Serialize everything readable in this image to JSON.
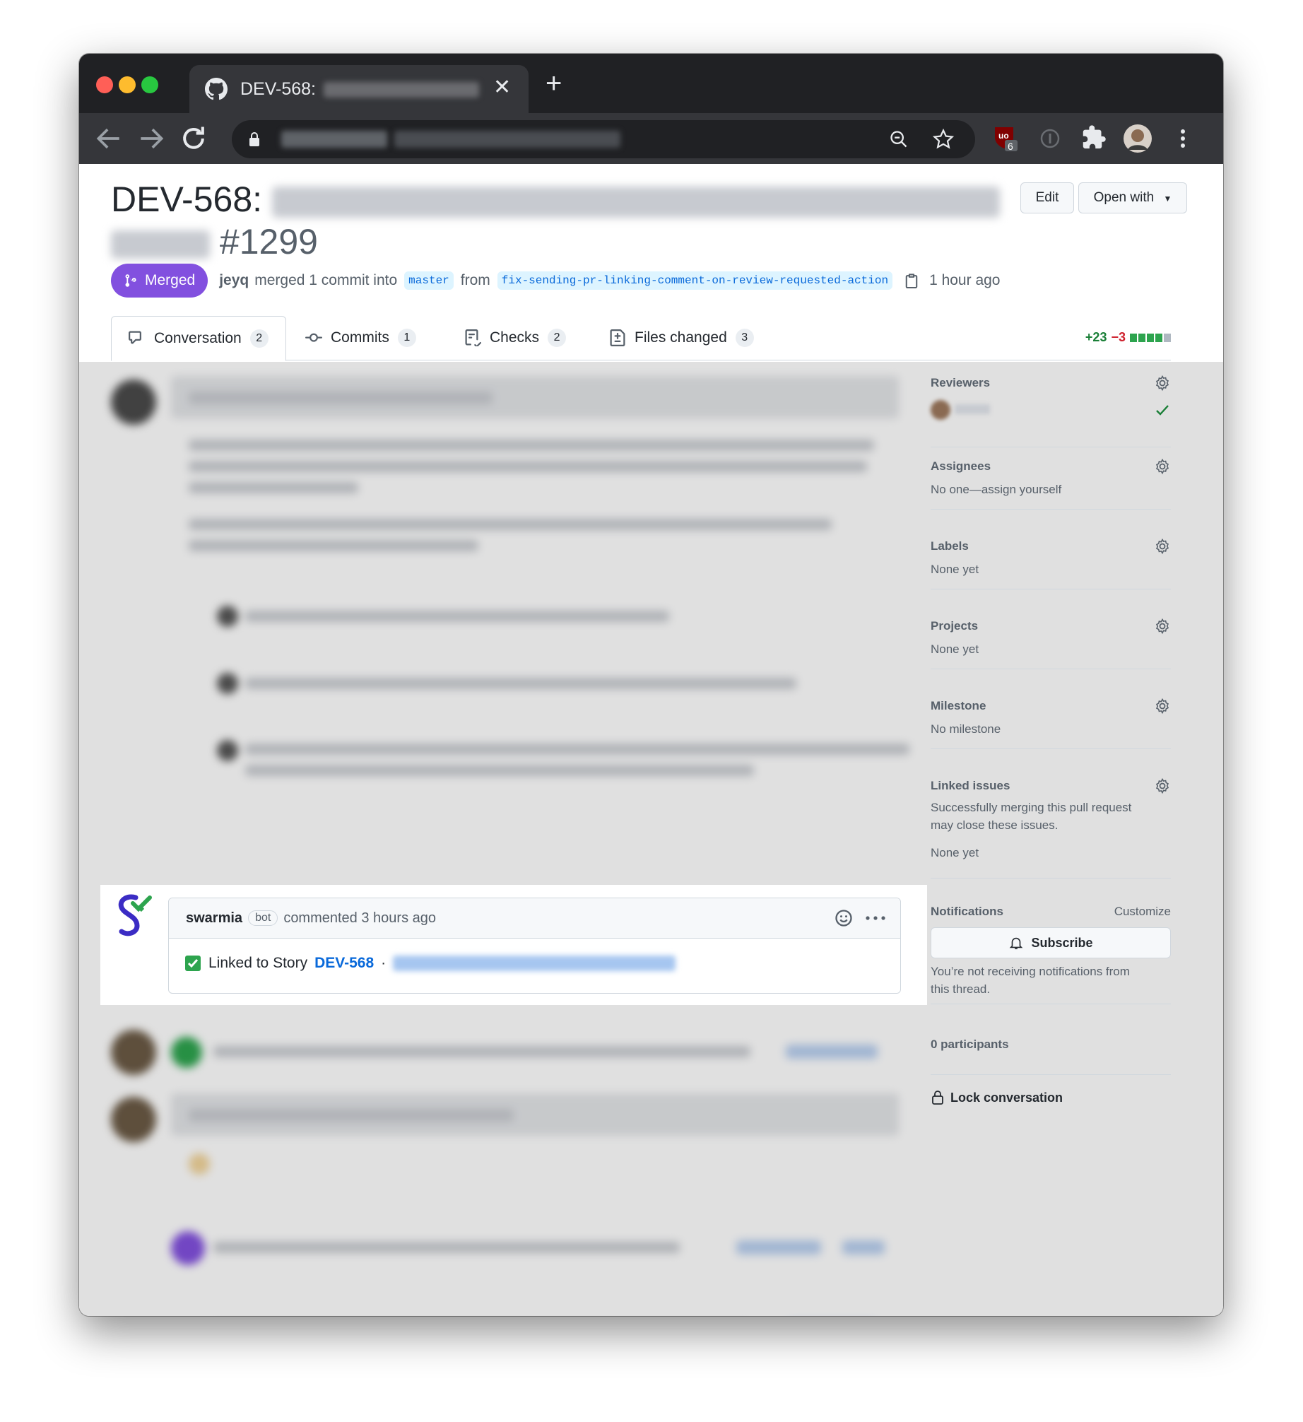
{
  "browser": {
    "tab_title": "DEV-568:",
    "tab_close": "✕",
    "new_tab": "+",
    "ext_badge_count": "6"
  },
  "pr": {
    "title_prefix": "DEV-568:",
    "number": "#1299",
    "edit_label": "Edit",
    "open_with_label": "Open with",
    "status": "Merged",
    "author": "jeyq",
    "merged_text": "merged 1 commit into",
    "base_branch": "master",
    "from_text": "from",
    "head_branch": "fix-sending-pr-linking-comment-on-review-requested-action",
    "time": "1 hour ago"
  },
  "tabs": [
    {
      "label": "Conversation",
      "count": "2"
    },
    {
      "label": "Commits",
      "count": "1"
    },
    {
      "label": "Checks",
      "count": "2"
    },
    {
      "label": "Files changed",
      "count": "3"
    }
  ],
  "diffstat": {
    "additions": "+23",
    "deletions": "−3"
  },
  "highlight_comment": {
    "author": "swarmia",
    "bot_tag": "bot",
    "action": "commented 3 hours ago",
    "body_prefix": "Linked to Story",
    "story_link": "DEV-568",
    "separator": "·"
  },
  "sidebar": {
    "reviewers": {
      "title": "Reviewers"
    },
    "assignees": {
      "title": "Assignees",
      "value": "No one—assign yourself"
    },
    "labels": {
      "title": "Labels",
      "value": "None yet"
    },
    "projects": {
      "title": "Projects",
      "value": "None yet"
    },
    "milestone": {
      "title": "Milestone",
      "value": "No milestone"
    },
    "linked_issues": {
      "title": "Linked issues",
      "line1": "Successfully merging this pull request",
      "line2": "may close these issues.",
      "value": "None yet"
    },
    "notifications": {
      "title": "Notifications",
      "customize": "Customize",
      "subscribe": "Subscribe",
      "line1": "You’re not receiving notifications from",
      "line2": "this thread."
    },
    "participants": "0 participants",
    "lock": "Lock conversation"
  },
  "colors": {
    "merged_purple": "#8250df",
    "link_blue": "#0969da",
    "add_green": "#1a7f37",
    "del_red": "#cf222e"
  }
}
